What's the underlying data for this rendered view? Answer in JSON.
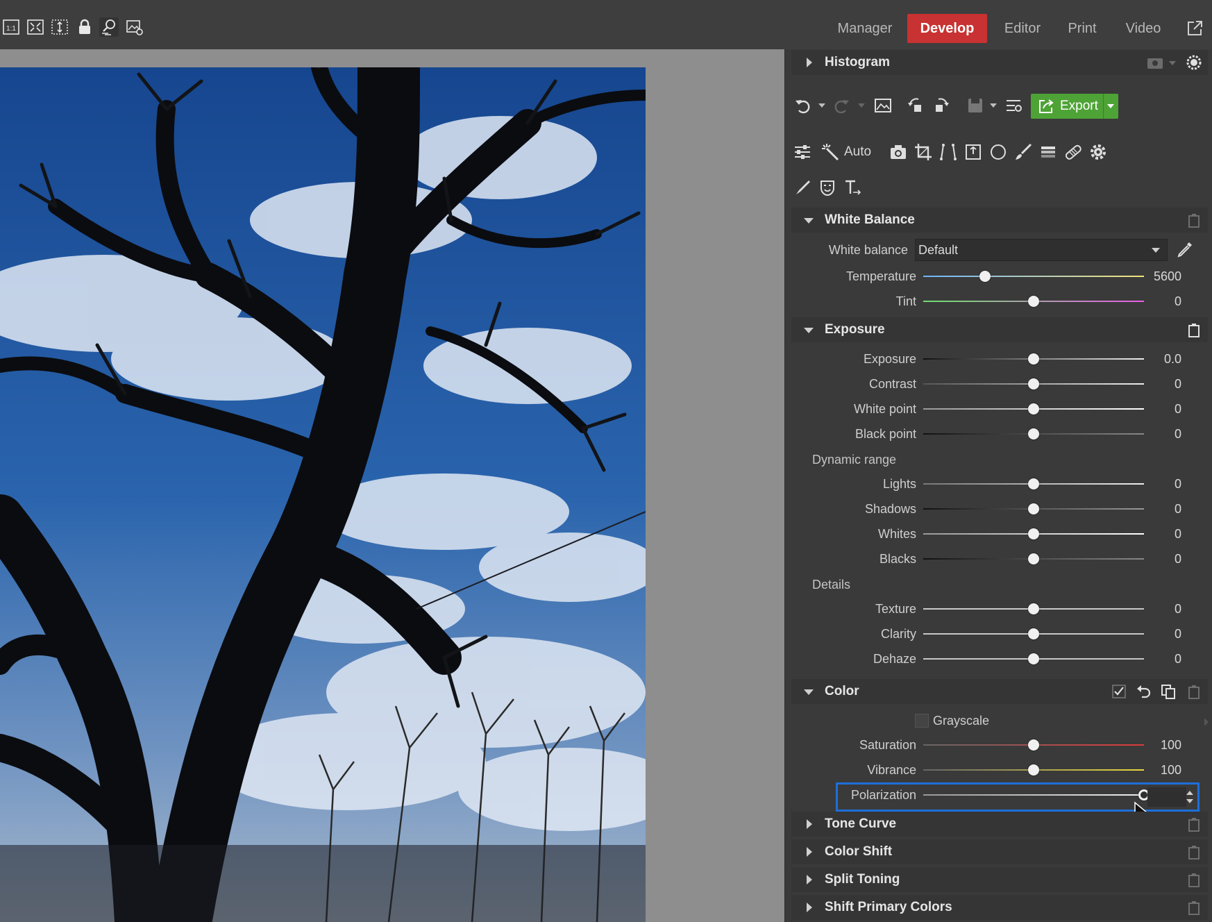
{
  "toolbar": {
    "icons": [
      "zoom-1-1-icon",
      "fit-screen-icon",
      "fit-height-icon",
      "lock-icon",
      "compare-icon",
      "image-settings-icon"
    ],
    "zoom_label": "1:1"
  },
  "modes": {
    "manager": "Manager",
    "develop": "Develop",
    "editor": "Editor",
    "print": "Print",
    "video": "Video",
    "active": "Develop"
  },
  "panel": {
    "histogram": {
      "title": "Histogram"
    },
    "actions": {
      "export_label": "Export"
    },
    "tools": {
      "auto_label": "Auto"
    },
    "white_balance": {
      "title": "White Balance",
      "wb_label": "White balance",
      "wb_value": "Default",
      "sliders": [
        {
          "label": "Temperature",
          "value": "5600",
          "level": 0.28
        },
        {
          "label": "Tint",
          "value": "0",
          "level": 0.5
        }
      ]
    },
    "exposure": {
      "title": "Exposure",
      "sliders": [
        {
          "label": "Exposure",
          "value": "0.0",
          "level": 0.5
        },
        {
          "label": "Contrast",
          "value": "0",
          "level": 0.5
        },
        {
          "label": "White point",
          "value": "0",
          "level": 0.5
        },
        {
          "label": "Black point",
          "value": "0",
          "level": 0.5
        }
      ],
      "dynamic_range_label": "Dynamic range",
      "dynamic_range": [
        {
          "label": "Lights",
          "value": "0",
          "level": 0.5
        },
        {
          "label": "Shadows",
          "value": "0",
          "level": 0.5
        },
        {
          "label": "Whites",
          "value": "0",
          "level": 0.5
        },
        {
          "label": "Blacks",
          "value": "0",
          "level": 0.5
        }
      ],
      "details_label": "Details",
      "details": [
        {
          "label": "Texture",
          "value": "0",
          "level": 0.5
        },
        {
          "label": "Clarity",
          "value": "0",
          "level": 0.5
        },
        {
          "label": "Dehaze",
          "value": "0",
          "level": 0.5
        }
      ]
    },
    "color": {
      "title": "Color",
      "grayscale_label": "Grayscale",
      "grayscale_checked": false,
      "sliders": [
        {
          "label": "Saturation",
          "value": "100",
          "level": 0.5
        },
        {
          "label": "Vibrance",
          "value": "100",
          "level": 0.5
        },
        {
          "label": "Polarization",
          "value": "100",
          "level": 1.0
        }
      ]
    },
    "collapsed_sections": [
      "Tone Curve",
      "Color Shift",
      "Split Toning",
      "Shift Primary Colors"
    ]
  },
  "colors": {
    "develop_active": "#c83232",
    "export_green": "#4ea336",
    "focus_outline": "#1e6fd9"
  }
}
